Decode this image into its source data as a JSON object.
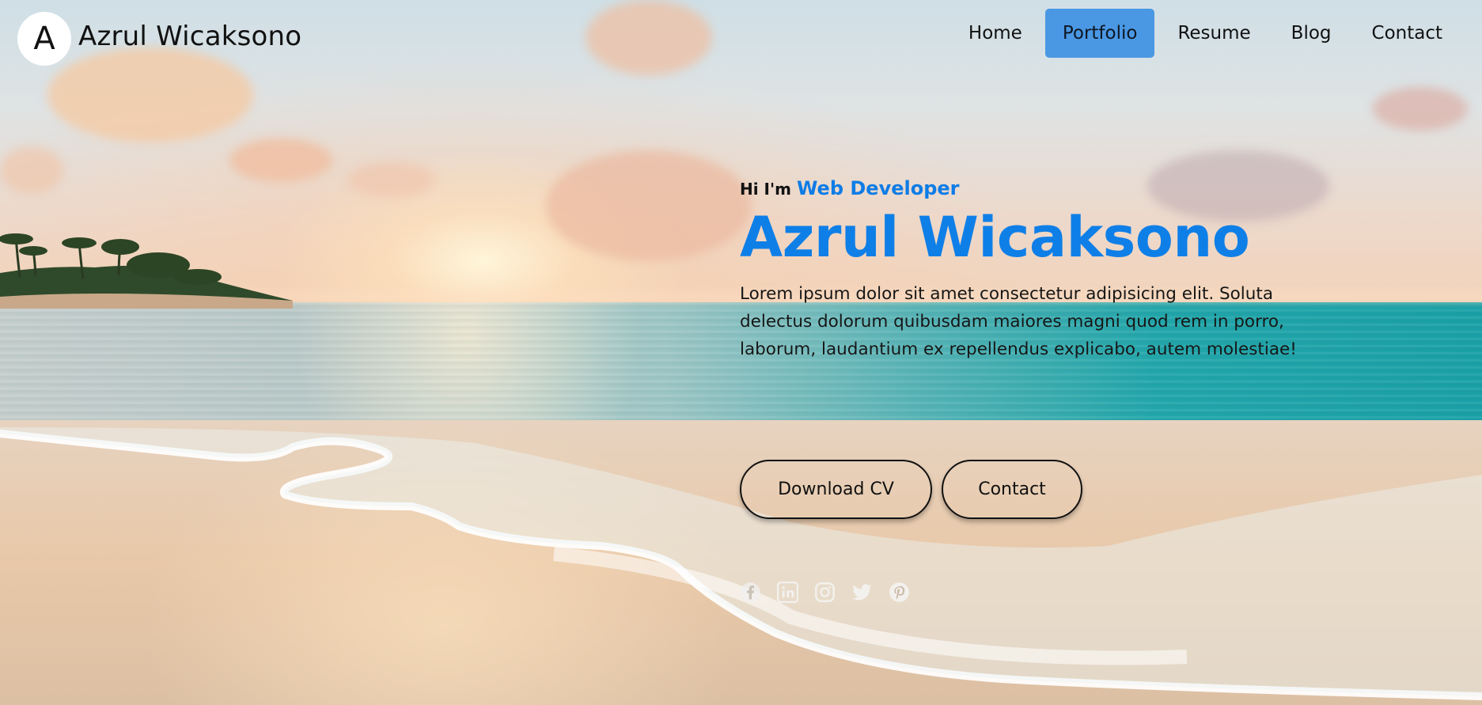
{
  "nav": {
    "logo_letter": "A",
    "brand": "Azrul Wicaksono",
    "items": [
      {
        "label": "Home",
        "active": false
      },
      {
        "label": "Portfolio",
        "active": true
      },
      {
        "label": "Resume",
        "active": false
      },
      {
        "label": "Blog",
        "active": false
      },
      {
        "label": "Contact",
        "active": false
      }
    ]
  },
  "hero": {
    "greeting": "Hi I'm",
    "role": "Web Developer",
    "name": "Azrul Wicaksono",
    "description": "Lorem ipsum dolor sit amet consectetur adipisicing elit. Soluta delectus dolorum quibusdam maiores magni quod rem in porro, laborum, laudantium ex repellendus explicabo, autem molestiae!",
    "buttons": {
      "download_cv": "Download CV",
      "contact": "Contact"
    }
  },
  "social": [
    "facebook-icon",
    "linkedin-icon",
    "instagram-icon",
    "twitter-icon",
    "pinterest-icon"
  ],
  "colors": {
    "accent": "#0f7fe8",
    "nav_active_bg": "#4a98e4",
    "text": "#111111"
  }
}
